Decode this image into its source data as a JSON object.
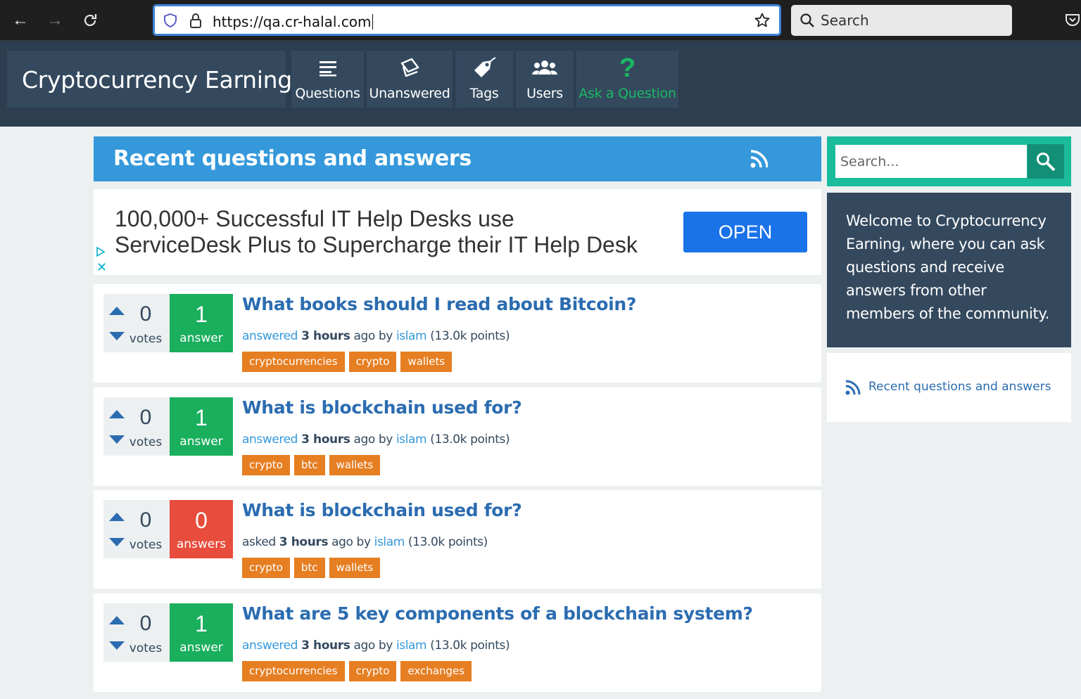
{
  "browser": {
    "url": "https://qa.cr-halal.com",
    "search_placeholder": "Search"
  },
  "site": {
    "logo": "Cryptocurrency Earning",
    "nav": [
      {
        "label": "Questions",
        "icon": "list-icon"
      },
      {
        "label": "Unanswered",
        "icon": "unanswered-icon"
      },
      {
        "label": "Tags",
        "icon": "tag-icon"
      },
      {
        "label": "Users",
        "icon": "users-icon"
      },
      {
        "label": "Ask a Question",
        "icon": "question-mark-icon"
      }
    ]
  },
  "main": {
    "title": "Recent questions and answers",
    "ad": {
      "line1": "100,000+ Successful IT Help Desks use",
      "line2": "ServiceDesk Plus to Supercharge their IT Help Desk",
      "button": "OPEN"
    },
    "questions": [
      {
        "votes": "0",
        "votes_label": "votes",
        "answers": "1",
        "answers_label": "answer",
        "answered": true,
        "title": "What books should I read about Bitcoin?",
        "action": "answered",
        "when": "3 hours",
        "ago": "ago by",
        "user": "islam",
        "points": "(13.0k points)",
        "tags": [
          "cryptocurrencies",
          "crypto",
          "wallets"
        ]
      },
      {
        "votes": "0",
        "votes_label": "votes",
        "answers": "1",
        "answers_label": "answer",
        "answered": true,
        "title": "What is blockchain used for?",
        "action": "answered",
        "when": "3 hours",
        "ago": "ago by",
        "user": "islam",
        "points": "(13.0k points)",
        "tags": [
          "crypto",
          "btc",
          "wallets"
        ]
      },
      {
        "votes": "0",
        "votes_label": "votes",
        "answers": "0",
        "answers_label": "answers",
        "answered": false,
        "title": "What is blockchain used for?",
        "action": "asked",
        "when": "3 hours",
        "ago": "ago by",
        "user": "islam",
        "points": "(13.0k points)",
        "tags": [
          "crypto",
          "btc",
          "wallets"
        ]
      },
      {
        "votes": "0",
        "votes_label": "votes",
        "answers": "1",
        "answers_label": "answer",
        "answered": true,
        "title": "What are 5 key components of a blockchain system?",
        "action": "answered",
        "when": "3 hours",
        "ago": "ago by",
        "user": "islam",
        "points": "(13.0k points)",
        "tags": [
          "cryptocurrencies",
          "crypto",
          "exchanges"
        ]
      }
    ]
  },
  "sidebar": {
    "search_placeholder": "Search...",
    "welcome": "Welcome to Cryptocurrency Earning, where you can ask questions and receive answers from other members of the community.",
    "feed_link": "Recent questions and answers"
  },
  "colors": {
    "header": "#2c3e50",
    "title_bar": "#3498db",
    "answered": "#1aaf5d",
    "unanswered": "#e74c3c",
    "tag": "#e67e22",
    "accent_search": "#1abc9c"
  }
}
